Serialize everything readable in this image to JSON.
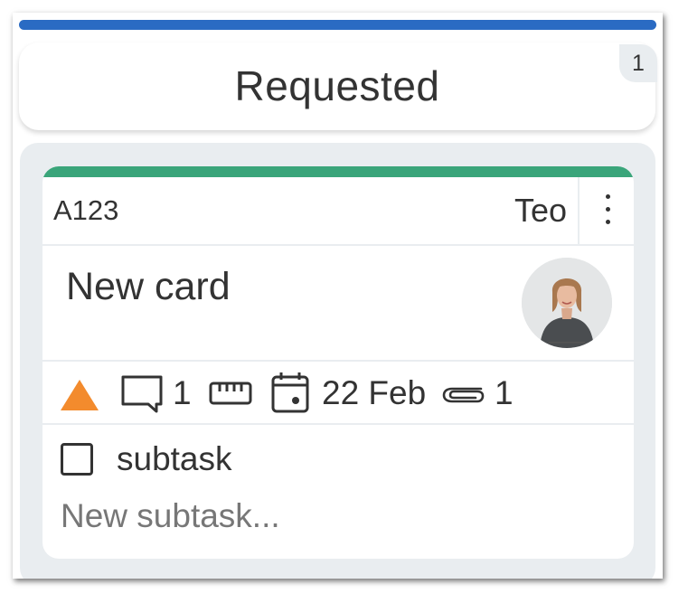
{
  "column": {
    "title": "Requested",
    "card_count": "1",
    "accent_color": "#2a6bc3"
  },
  "card": {
    "id": "A123",
    "owner": "Teo",
    "title": "New card",
    "accent_color": "#3aa57a",
    "avatar_icon": "user-photo",
    "meta": {
      "priority_icon": "warning-triangle-icon",
      "priority_color": "#f38b2d",
      "comments_count": "1",
      "size_icon": "ruler-icon",
      "due_date": "22 Feb",
      "attachments_count": "1"
    },
    "subtasks": [
      {
        "label": "subtask",
        "checked": false
      }
    ],
    "new_subtask_placeholder": "New subtask..."
  }
}
